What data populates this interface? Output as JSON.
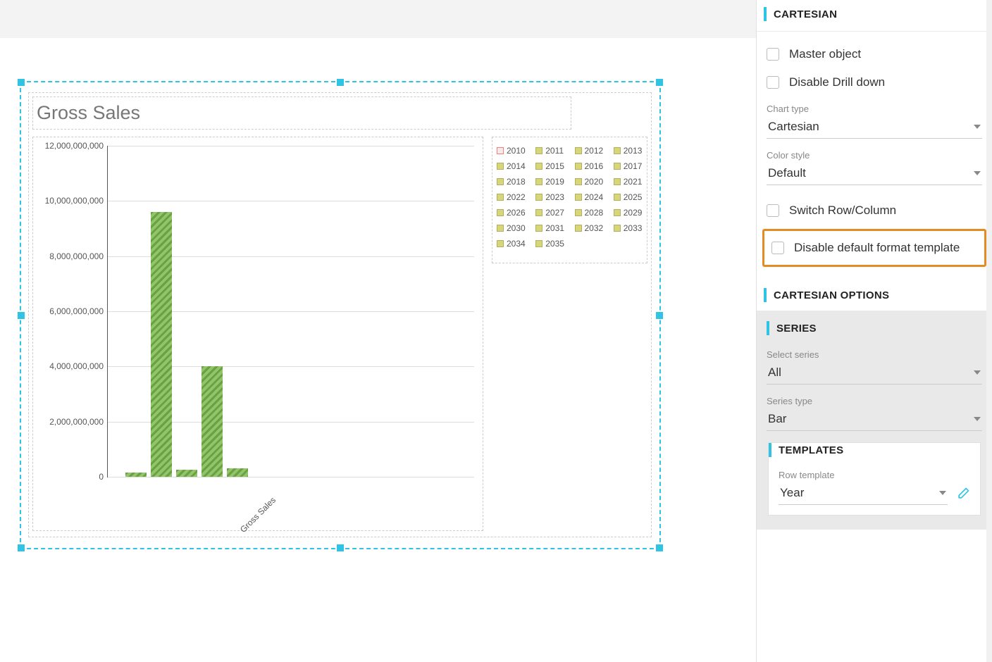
{
  "chart_data": {
    "type": "bar",
    "title": "Gross Sales",
    "xlabel": "Gross Sales",
    "ylabel": "",
    "ylim": [
      0,
      12000000000
    ],
    "yticks": [
      {
        "value": 0,
        "label": "0"
      },
      {
        "value": 2000000000,
        "label": "2,000,000,000"
      },
      {
        "value": 4000000000,
        "label": "4,000,000,000"
      },
      {
        "value": 6000000000,
        "label": "6,000,000,000"
      },
      {
        "value": 8000000000,
        "label": "8,000,000,000"
      },
      {
        "value": 10000000000,
        "label": "10,000,000,000"
      },
      {
        "value": 12000000000,
        "label": "12,000,000,000"
      }
    ],
    "bars": [
      {
        "value": 150000000
      },
      {
        "value": 9600000000
      },
      {
        "value": 250000000
      },
      {
        "value": 4000000000
      },
      {
        "value": 300000000
      }
    ],
    "legend": [
      "2010",
      "2011",
      "2012",
      "2013",
      "2014",
      "2015",
      "2016",
      "2017",
      "2018",
      "2019",
      "2020",
      "2021",
      "2022",
      "2023",
      "2024",
      "2025",
      "2026",
      "2027",
      "2028",
      "2029",
      "2030",
      "2031",
      "2032",
      "2033",
      "2034",
      "2035"
    ]
  },
  "panel": {
    "cartesian_title": "CARTESIAN",
    "master_object": "Master object",
    "disable_drill": "Disable Drill down",
    "chart_type_label": "Chart type",
    "chart_type_value": "Cartesian",
    "color_style_label": "Color style",
    "color_style_value": "Default",
    "switch_rowcol": "Switch Row/Column",
    "disable_default_format": "Disable default format template",
    "cart_options_title": "CARTESIAN OPTIONS",
    "series_title": "SERIES",
    "select_series_label": "Select series",
    "select_series_value": "All",
    "series_type_label": "Series type",
    "series_type_value": "Bar",
    "templates_title": "TEMPLATES",
    "row_template_label": "Row template",
    "row_template_value": "Year"
  }
}
